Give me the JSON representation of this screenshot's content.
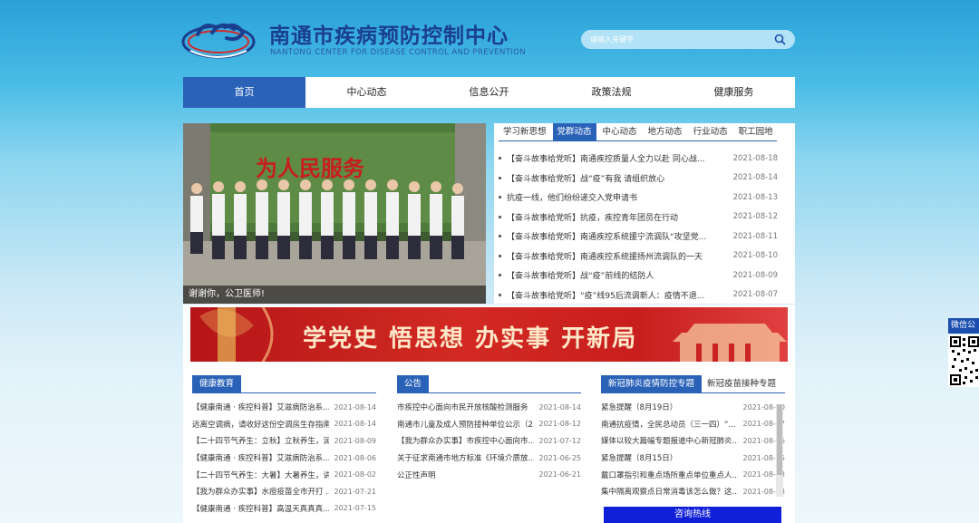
{
  "header": {
    "title": "南通市疾病预防控制中心",
    "subtitle": "NANTONG CENTER FOR DISEASE CONTROL AND PREVENTION",
    "search_placeholder": "请输入关键字"
  },
  "nav": {
    "items": [
      {
        "label": "首页"
      },
      {
        "label": "中心动态"
      },
      {
        "label": "信息公开"
      },
      {
        "label": "政策法规"
      },
      {
        "label": "健康服务"
      }
    ]
  },
  "photo": {
    "caption": "谢谢你，公卫医师!"
  },
  "news": {
    "tabs": [
      {
        "label": "学习新思想"
      },
      {
        "label": "党群动态"
      },
      {
        "label": "中心动态"
      },
      {
        "label": "地方动态"
      },
      {
        "label": "行业动态"
      },
      {
        "label": "职工园地"
      }
    ],
    "items": [
      {
        "title": "【奋斗故事给党听】南通疾控质量人全力以赴 同心战...",
        "date": "2021-08-18"
      },
      {
        "title": "【奋斗故事给党听】战“疫”有我 请组织放心",
        "date": "2021-08-14"
      },
      {
        "title": "抗疫一线，他们纷纷递交入党申请书",
        "date": "2021-08-13"
      },
      {
        "title": "【奋斗故事给党听】抗疫，疾控青年团员在行动",
        "date": "2021-08-12"
      },
      {
        "title": "【奋斗故事给党听】南通疾控系统援宁流调队“攻坚党...",
        "date": "2021-08-11"
      },
      {
        "title": "【奋斗故事给党听】南通疾控系统援扬州流调队的一天",
        "date": "2021-08-10"
      },
      {
        "title": "【奋斗故事给党听】战“疫”前线的结防人",
        "date": "2021-08-09"
      },
      {
        "title": "【奋斗故事给党听】“疫”线95后流调新人：疫情不退...",
        "date": "2021-08-07"
      }
    ]
  },
  "banner": {
    "text": "学党史 悟思想 办实事 开新局"
  },
  "health": {
    "tab": "健康教育",
    "items": [
      {
        "title": "【健康南通 · 疾控科普】艾滋病防治系...",
        "date": "2021-08-14"
      },
      {
        "title": "远离空调病，请收好这份空调房生存指南",
        "date": "2021-08-14"
      },
      {
        "title": "【二十四节气养生：立秋】立秋养生，润...",
        "date": "2021-08-09"
      },
      {
        "title": "【健康南通 · 疾控科普】艾滋病防治系...",
        "date": "2021-08-06"
      },
      {
        "title": "【二十四节气养生：大暑】大暑养生，讲...",
        "date": "2021-08-02"
      },
      {
        "title": "【我为群众办实事】水痘疫苗全市开打 ...",
        "date": "2021-07-21"
      },
      {
        "title": "【健康南通 · 疾控科普】高温天真真真...",
        "date": "2021-07-15"
      }
    ]
  },
  "notice": {
    "tab": "公告",
    "items": [
      {
        "title": "市疾控中心面向市民开放核酸检测服务",
        "date": "2021-08-14"
      },
      {
        "title": "南通市儿童及成人预防接种单位公示（2...",
        "date": "2021-08-12"
      },
      {
        "title": "【我为群众办实事】市疾控中心面向市...",
        "date": "2021-07-12"
      },
      {
        "title": "关于征求南通市地方标准《环境介质放...",
        "date": "2021-06-25"
      },
      {
        "title": "公正性声明",
        "date": "2021-06-21"
      }
    ]
  },
  "covid": {
    "tab": "新冠肺炎疫情防控专题",
    "tab2": "新冠疫苗接种专题",
    "items": [
      {
        "title": "紧急提醒（8月19日）",
        "date": "2021-08-20"
      },
      {
        "title": "南通抗疫情，全民总动员（三一四）“...",
        "date": "2021-08-17"
      },
      {
        "title": "媒体以较大篇幅专题报道中心新冠肺炎...",
        "date": "2021-08-16"
      },
      {
        "title": "紧急提醒（8月15日）",
        "date": "2021-08-15"
      },
      {
        "title": "戴口罩指引和重点场所重点单位重点人...",
        "date": "2021-08-13"
      },
      {
        "title": "集中隔离观察点日常消毒该怎么做？这...",
        "date": "2021-08-13"
      }
    ],
    "hotline": "咨询热线"
  },
  "wechat": {
    "label": "微信公"
  },
  "colors": {
    "accent": "#2a62b8",
    "banner_red": "#c81e1e",
    "hotline": "#1020d8"
  }
}
